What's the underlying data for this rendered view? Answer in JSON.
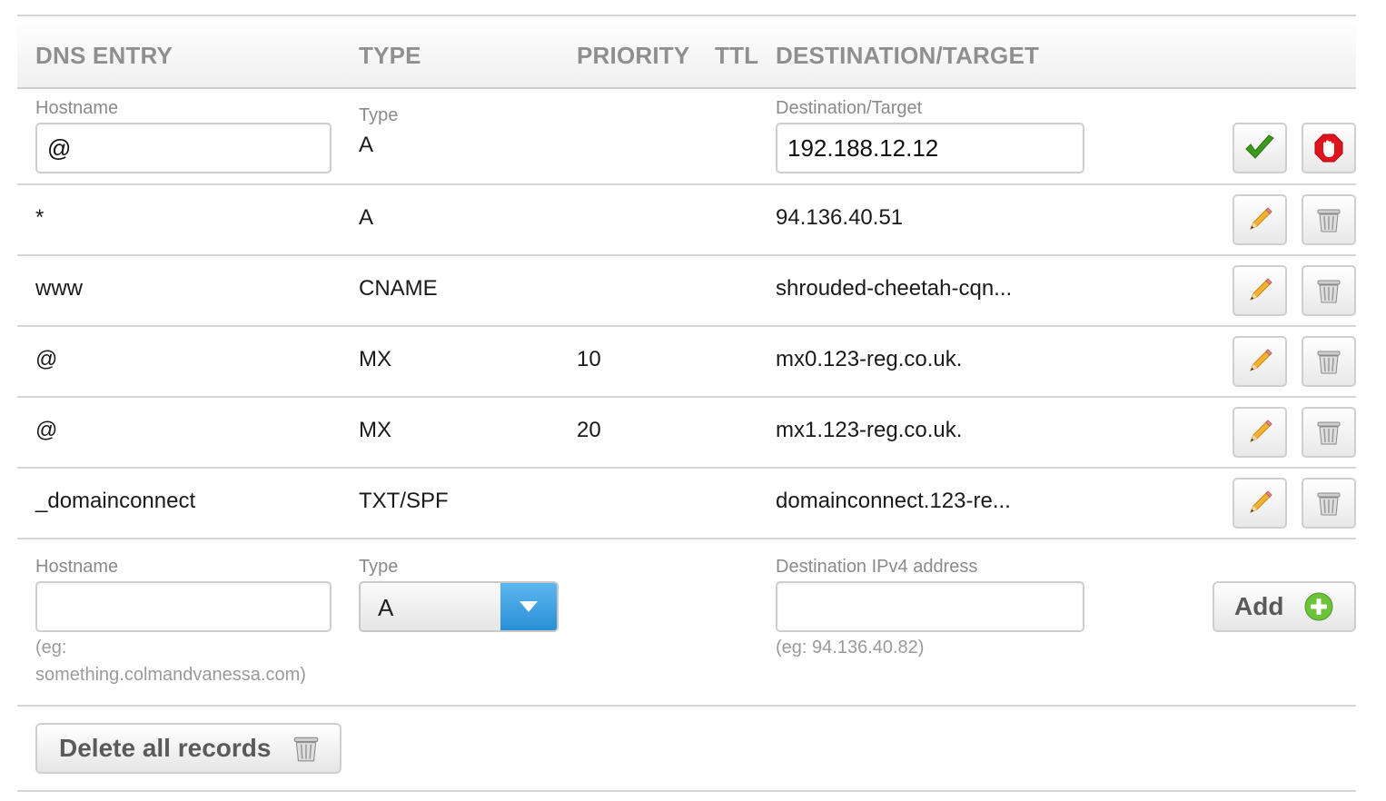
{
  "header": {
    "dns_entry": "DNS ENTRY",
    "type": "TYPE",
    "priority": "PRIORITY",
    "ttl": "TTL",
    "destination": "DESTINATION/TARGET"
  },
  "edit_row": {
    "hostname_label": "Hostname",
    "hostname_value": "@",
    "type_label": "Type",
    "type_value": "A",
    "destination_label": "Destination/Target",
    "destination_value": "192.188.12.12",
    "confirm_icon": "checkmark-icon",
    "cancel_icon": "stop-icon"
  },
  "records": [
    {
      "hostname": "*",
      "type": "A",
      "priority": "",
      "destination": "94.136.40.51"
    },
    {
      "hostname": "www",
      "type": "CNAME",
      "priority": "",
      "destination": "shrouded-cheetah-cqn..."
    },
    {
      "hostname": "@",
      "type": "MX",
      "priority": "10",
      "destination": "mx0.123-reg.co.uk."
    },
    {
      "hostname": "@",
      "type": "MX",
      "priority": "20",
      "destination": "mx1.123-reg.co.uk."
    },
    {
      "hostname": "_domainconnect",
      "type": "TXT/SPF",
      "priority": "",
      "destination": "domainconnect.123-re..."
    }
  ],
  "record_icons": {
    "edit": "pencil-icon",
    "delete": "trash-icon"
  },
  "add_row": {
    "hostname_label": "Hostname",
    "hostname_value": "",
    "hostname_hint_line1": "(eg:",
    "hostname_hint_line2": "something.colmandvanessa.com)",
    "type_label": "Type",
    "type_value": "A",
    "destination_label": "Destination IPv4 address",
    "destination_value": "",
    "destination_hint": "(eg: 94.136.40.82)",
    "add_label": "Add",
    "add_icon": "plus-circle-icon"
  },
  "footer": {
    "delete_all_label": "Delete all records",
    "delete_all_icon": "trash-icon"
  },
  "colors": {
    "accent_blue": "#2a8fd6",
    "confirm_green": "#3a9a1c",
    "cancel_red": "#e0141e",
    "add_green": "#6cc33a"
  }
}
